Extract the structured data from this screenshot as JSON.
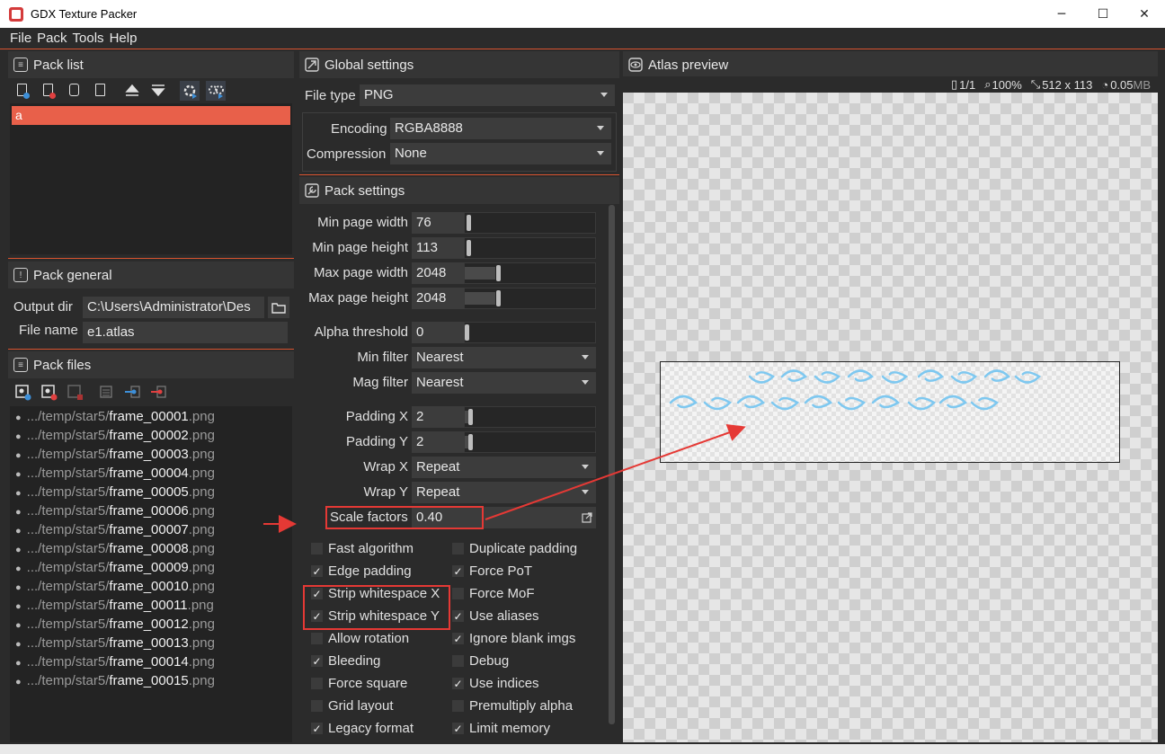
{
  "window": {
    "title": "GDX Texture Packer",
    "minimize": "─",
    "maximize": "☐",
    "close": "✕"
  },
  "menu": [
    "File",
    "Pack",
    "Tools",
    "Help"
  ],
  "pack_list": {
    "title": "Pack list",
    "items": [
      "a"
    ]
  },
  "pack_general": {
    "title": "Pack general",
    "output_dir_label": "Output dir",
    "output_dir_value": "C:\\Users\\Administrator\\Des",
    "file_name_label": "File name",
    "file_name_value": "e1.atlas"
  },
  "pack_files": {
    "title": "Pack files",
    "files": [
      {
        "path": ".../temp/star5/",
        "name": "frame_00001",
        "ext": ".png"
      },
      {
        "path": ".../temp/star5/",
        "name": "frame_00002",
        "ext": ".png"
      },
      {
        "path": ".../temp/star5/",
        "name": "frame_00003",
        "ext": ".png"
      },
      {
        "path": ".../temp/star5/",
        "name": "frame_00004",
        "ext": ".png"
      },
      {
        "path": ".../temp/star5/",
        "name": "frame_00005",
        "ext": ".png"
      },
      {
        "path": ".../temp/star5/",
        "name": "frame_00006",
        "ext": ".png"
      },
      {
        "path": ".../temp/star5/",
        "name": "frame_00007",
        "ext": ".png"
      },
      {
        "path": ".../temp/star5/",
        "name": "frame_00008",
        "ext": ".png"
      },
      {
        "path": ".../temp/star5/",
        "name": "frame_00009",
        "ext": ".png"
      },
      {
        "path": ".../temp/star5/",
        "name": "frame_00010",
        "ext": ".png"
      },
      {
        "path": ".../temp/star5/",
        "name": "frame_00011",
        "ext": ".png"
      },
      {
        "path": ".../temp/star5/",
        "name": "frame_00012",
        "ext": ".png"
      },
      {
        "path": ".../temp/star5/",
        "name": "frame_00013",
        "ext": ".png"
      },
      {
        "path": ".../temp/star5/",
        "name": "frame_00014",
        "ext": ".png"
      },
      {
        "path": ".../temp/star5/",
        "name": "frame_00015",
        "ext": ".png"
      }
    ]
  },
  "global_settings": {
    "title": "Global settings",
    "file_type_label": "File type",
    "file_type_value": "PNG",
    "encoding_label": "Encoding",
    "encoding_value": "RGBA8888",
    "compression_label": "Compression",
    "compression_value": "None"
  },
  "pack_settings": {
    "title": "Pack settings",
    "min_page_width_label": "Min page width",
    "min_page_width_value": "76",
    "min_page_height_label": "Min page height",
    "min_page_height_value": "113",
    "max_page_width_label": "Max page width",
    "max_page_width_value": "2048",
    "max_page_height_label": "Max page height",
    "max_page_height_value": "2048",
    "alpha_threshold_label": "Alpha threshold",
    "alpha_threshold_value": "0",
    "min_filter_label": "Min filter",
    "min_filter_value": "Nearest",
    "mag_filter_label": "Mag filter",
    "mag_filter_value": "Nearest",
    "padding_x_label": "Padding X",
    "padding_x_value": "2",
    "padding_y_label": "Padding Y",
    "padding_y_value": "2",
    "wrap_x_label": "Wrap X",
    "wrap_x_value": "Repeat",
    "wrap_y_label": "Wrap Y",
    "wrap_y_value": "Repeat",
    "scale_factors_label": "Scale factors",
    "scale_factors_value": "0.40",
    "checkboxes_left": [
      {
        "label": "Fast algorithm",
        "checked": false
      },
      {
        "label": "Edge padding",
        "checked": true
      },
      {
        "label": "Strip whitespace X",
        "checked": true
      },
      {
        "label": "Strip whitespace Y",
        "checked": true
      },
      {
        "label": "Allow rotation",
        "checked": false
      },
      {
        "label": "Bleeding",
        "checked": true
      },
      {
        "label": "Force square",
        "checked": false
      },
      {
        "label": "Grid layout",
        "checked": false
      },
      {
        "label": "Legacy format",
        "checked": true
      }
    ],
    "checkboxes_right": [
      {
        "label": "Duplicate padding",
        "checked": false
      },
      {
        "label": "Force PoT",
        "checked": true
      },
      {
        "label": "Force MoF",
        "checked": false
      },
      {
        "label": "Use aliases",
        "checked": true
      },
      {
        "label": "Ignore blank imgs",
        "checked": true
      },
      {
        "label": "Debug",
        "checked": false
      },
      {
        "label": "Use indices",
        "checked": true
      },
      {
        "label": "Premultiply alpha",
        "checked": false
      },
      {
        "label": "Limit memory",
        "checked": true
      }
    ]
  },
  "atlas_preview": {
    "title": "Atlas preview",
    "page": "1/1",
    "zoom": "100%",
    "size": "512 x 113",
    "file_size": "0.05",
    "file_size_unit": "MB"
  },
  "colors": {
    "accent": "#e8604a",
    "annotation": "#e53935",
    "sprite": "#7ec8f0"
  }
}
